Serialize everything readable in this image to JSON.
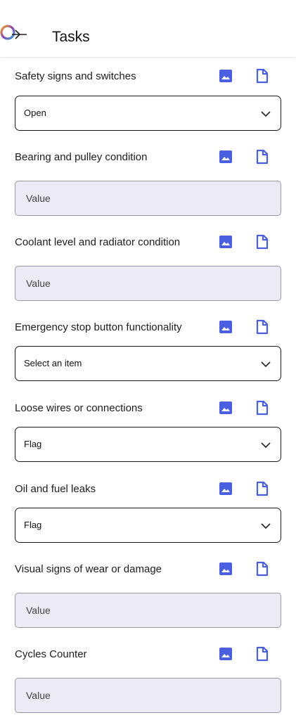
{
  "header": {
    "title": "Tasks",
    "logo_icon": "app-logo-icon"
  },
  "colors": {
    "accent": "#4a5ee0",
    "field_bg": "#ebeaf5"
  },
  "fields": [
    {
      "label": "Safety signs and switches",
      "type": "select",
      "value": "Open"
    },
    {
      "label": "Bearing and pulley condition",
      "type": "input",
      "placeholder": "Value"
    },
    {
      "label": "Coolant level and radiator condition",
      "type": "input",
      "placeholder": "Value"
    },
    {
      "label": "Emergency stop button functionality",
      "type": "select",
      "value": "Select an item"
    },
    {
      "label": "Loose wires or connections",
      "type": "select",
      "value": "Flag"
    },
    {
      "label": "Oil and fuel leaks",
      "type": "select",
      "value": "Flag"
    },
    {
      "label": "Visual signs of wear or damage",
      "type": "input",
      "placeholder": "Value"
    },
    {
      "label": "Cycles Counter",
      "type": "input",
      "placeholder": "Value"
    }
  ]
}
